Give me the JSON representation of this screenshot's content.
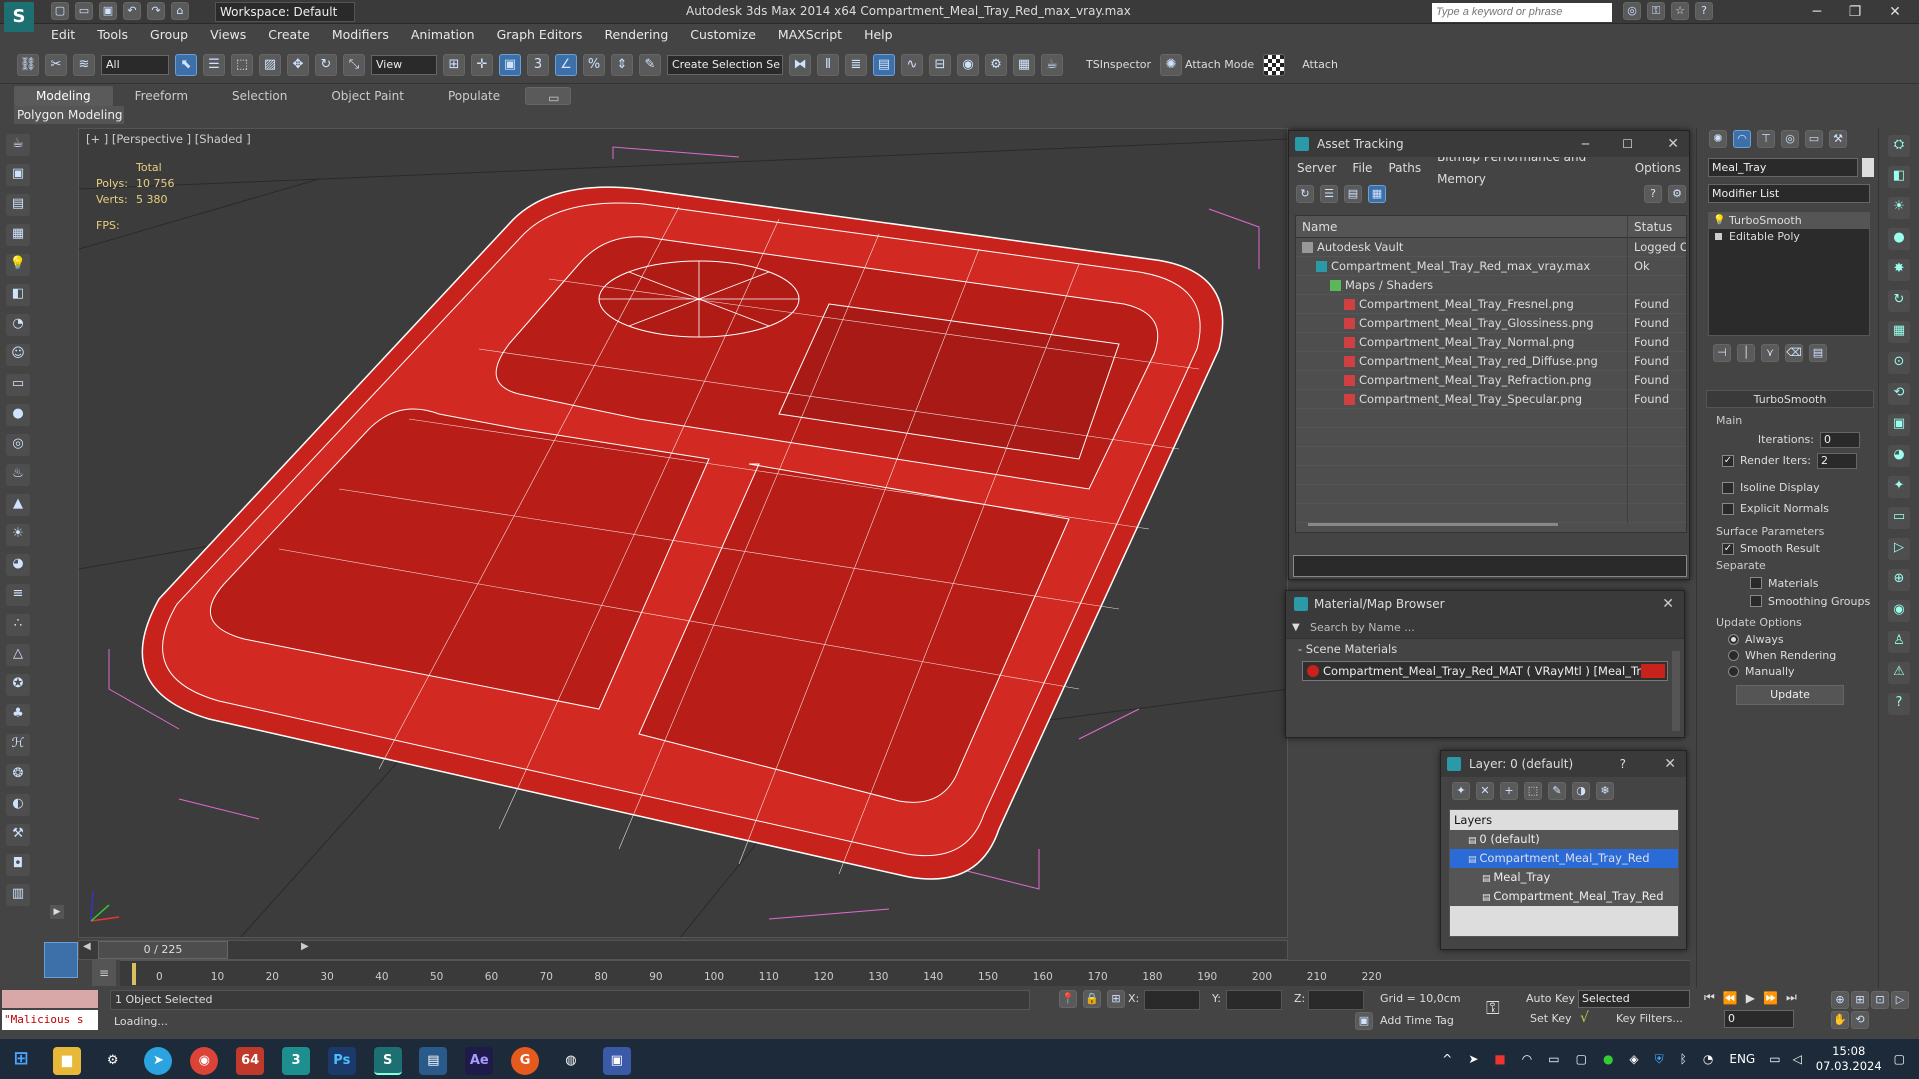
{
  "window": {
    "title": "Autodesk 3ds Max  2014 x64     Compartment_Meal_Tray_Red_max_vray.max",
    "workspace": "Workspace: Default",
    "search_placeholder": "Type a keyword or phrase"
  },
  "menu": [
    "Edit",
    "Tools",
    "Group",
    "Views",
    "Create",
    "Modifiers",
    "Animation",
    "Graph Editors",
    "Rendering",
    "Customize",
    "MAXScript",
    "Help"
  ],
  "toolbar": {
    "selection_filter": "All",
    "ref_coord": "View",
    "named_selection": "Create Selection Se",
    "tsinspector": "TSInspector",
    "attach_mode": "Attach Mode",
    "attach": "Attach"
  },
  "ribbon": {
    "tabs": [
      "Modeling",
      "Freeform",
      "Selection",
      "Object Paint",
      "Populate"
    ],
    "active_panel": "Polygon Modeling"
  },
  "viewport": {
    "label": "[+ ] [Perspective ] [Shaded ]",
    "stats_total": "Total",
    "polys_label": "Polys:",
    "polys_value": "10 756",
    "verts_label": "Verts:",
    "verts_value": "5 380",
    "fps_label": "FPS:"
  },
  "asset_tracking": {
    "title": "Asset Tracking",
    "menu": [
      "Server",
      "File",
      "Paths",
      "Bitmap Performance and Memory",
      "Options"
    ],
    "col_name": "Name",
    "col_status": "Status",
    "rows": [
      {
        "name": "Autodesk Vault",
        "status": "Logged O",
        "indent": 0,
        "kind": "vault"
      },
      {
        "name": "Compartment_Meal_Tray_Red_max_vray.max",
        "status": "Ok",
        "indent": 1,
        "kind": "max"
      },
      {
        "name": "Maps / Shaders",
        "status": "",
        "indent": 2,
        "kind": "folder"
      },
      {
        "name": "Compartment_Meal_Tray_Fresnel.png",
        "status": "Found",
        "indent": 3,
        "kind": "png"
      },
      {
        "name": "Compartment_Meal_Tray_Glossiness.png",
        "status": "Found",
        "indent": 3,
        "kind": "png"
      },
      {
        "name": "Compartment_Meal_Tray_Normal.png",
        "status": "Found",
        "indent": 3,
        "kind": "png"
      },
      {
        "name": "Compartment_Meal_Tray_red_Diffuse.png",
        "status": "Found",
        "indent": 3,
        "kind": "png"
      },
      {
        "name": "Compartment_Meal_Tray_Refraction.png",
        "status": "Found",
        "indent": 3,
        "kind": "png"
      },
      {
        "name": "Compartment_Meal_Tray_Specular.png",
        "status": "Found",
        "indent": 3,
        "kind": "png"
      }
    ]
  },
  "material_browser": {
    "title": "Material/Map Browser",
    "search_placeholder": "Search by Name ...",
    "category": "- Scene Materials",
    "item": "Compartment_Meal_Tray_Red_MAT  ( VRayMtl )  [Meal_Tray]"
  },
  "layer_window": {
    "title": "Layer: 0 (default)",
    "header": "Layers",
    "rows": [
      {
        "name": "0 (default)",
        "indent": 0,
        "selected": false
      },
      {
        "name": "Compartment_Meal_Tray_Red",
        "indent": 0,
        "selected": true
      },
      {
        "name": "Meal_Tray",
        "indent": 1,
        "selected": false
      },
      {
        "name": "Compartment_Meal_Tray_Red",
        "indent": 1,
        "selected": false
      }
    ]
  },
  "command_panel": {
    "object_name": "Meal_Tray",
    "modifier_list": "Modifier List",
    "stack": [
      "TurboSmooth",
      "Editable Poly"
    ],
    "rollout_title": "TurboSmooth",
    "main_label": "Main",
    "iterations_label": "Iterations:",
    "iterations_value": "0",
    "render_iters_label": "Render Iters:",
    "render_iters_value": "2",
    "isoline": "Isoline Display",
    "explicit_normals": "Explicit Normals",
    "surface_params": "Surface Parameters",
    "smooth_result": "Smooth Result",
    "separate": "Separate",
    "materials": "Materials",
    "smoothing_groups": "Smoothing Groups",
    "update_options": "Update Options",
    "always": "Always",
    "when_rendering": "When Rendering",
    "manually": "Manually",
    "update_button": "Update"
  },
  "timeline": {
    "frame": "0 / 225",
    "ticks": [
      "0",
      "10",
      "20",
      "30",
      "40",
      "50",
      "60",
      "70",
      "80",
      "90",
      "100",
      "110",
      "120",
      "130",
      "140",
      "150",
      "160",
      "170",
      "180",
      "190",
      "200",
      "210",
      "220"
    ]
  },
  "status": {
    "selection": "1 Object Selected",
    "prompt": "Loading...",
    "maxscript": "\"Malicious s",
    "x_label": "X:",
    "y_label": "Y:",
    "z_label": "Z:",
    "grid": "Grid = 10,0cm",
    "add_time_tag": "Add Time Tag",
    "auto_key": "Auto Key",
    "set_key": "Set Key",
    "key_mode": "Selected",
    "key_filters": "Key Filters...",
    "current_frame": "0"
  },
  "taskbar": {
    "lang": "ENG",
    "time": "15:08",
    "date": "07.03.2024"
  },
  "colors": {
    "mesh": "#c8221c",
    "wire": "#ffffff",
    "selection": "#2b6bd6"
  }
}
